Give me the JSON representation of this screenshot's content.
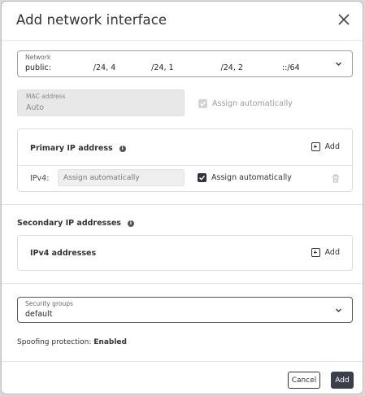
{
  "dialog": {
    "title": "Add network interface",
    "close_label": "×"
  },
  "network": {
    "label": "Network",
    "value_parts": [
      "public: ",
      "/24, 4",
      "/24, 1",
      "/24, 2",
      "::/64"
    ]
  },
  "mac": {
    "label": "MAC address",
    "value": "Auto",
    "assign_label": "Assign automatically",
    "assign_checked": true,
    "assign_disabled": true
  },
  "primary_ip": {
    "title": "Primary IP address",
    "add_label": "Add",
    "ipv4_label": "IPv4:",
    "ipv4_placeholder": "Assign automatically",
    "assign_label": "Assign automatically",
    "assign_checked": true
  },
  "secondary_ip": {
    "title": "Secondary IP addresses",
    "ipv4_title": "IPv4 addresses",
    "add_label": "Add"
  },
  "security_groups": {
    "label": "Security groups",
    "value": "default"
  },
  "spoofing": {
    "label": "Spoofing protection: ",
    "value": "Enabled"
  },
  "footer": {
    "cancel_label": "Cancel",
    "add_label": "Add"
  },
  "colors": {
    "primary_dark": "#3a3f4b",
    "checkbox_on": "#2f3440",
    "disabled_bg": "#e8e8e8"
  }
}
